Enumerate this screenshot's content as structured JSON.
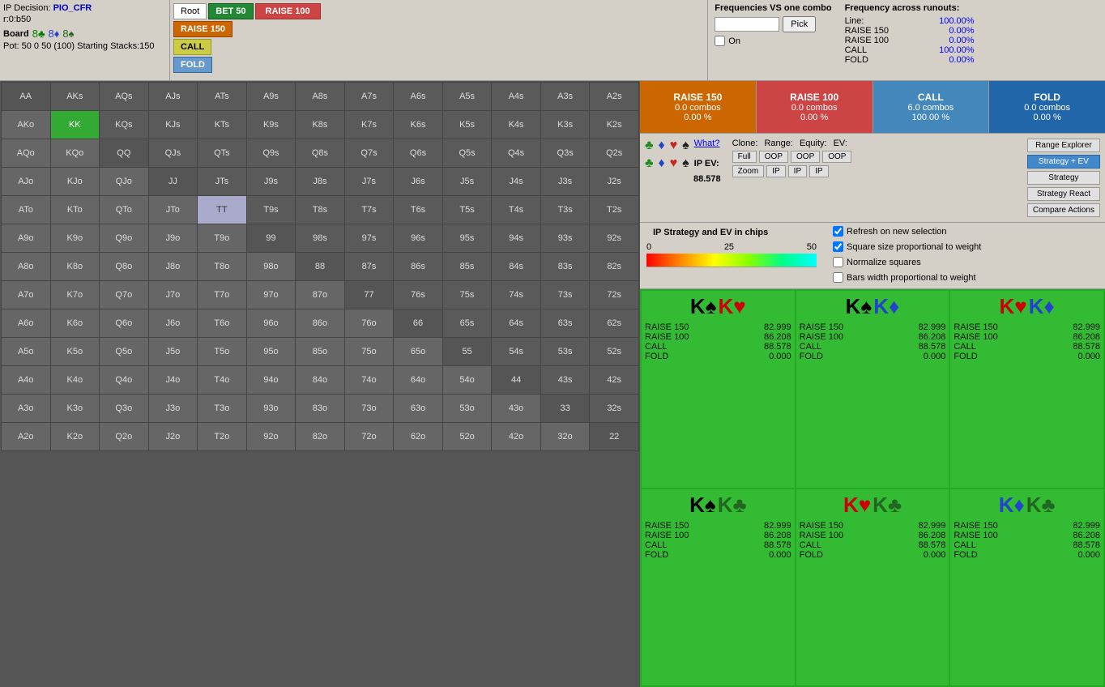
{
  "topBar": {
    "ipDecision": "IP Decision:",
    "ipDecisionValue": "PIO_CFR",
    "r0": "r:0:b50",
    "boardLabel": "Board",
    "cards": [
      "8♣",
      "8♦",
      "8♠"
    ],
    "potRow": "Pot: 50 0 50 (100) Starting Stacks:150",
    "buttons": {
      "root": "Root",
      "bet50": "BET 50",
      "raise100": "RAISE 100",
      "raise150": "RAISE 150",
      "call": "CALL",
      "fold": "FOLD"
    }
  },
  "freqPanel": {
    "title": "Frequencies VS one combo",
    "freqAcrossTitle": "Frequency across runouts:",
    "lineLabel": "Line:",
    "linePct": "100.00%",
    "onLabel": "On",
    "raise150Label": "RAISE 150",
    "raise150Pct": "0.00%",
    "raise100Label": "RAISE 100",
    "raise100Pct": "0.00%",
    "callLabel": "CALL",
    "callPct": "100.00%",
    "foldLabel": "FOLD",
    "foldPct": "0.00%"
  },
  "actionSummary": [
    {
      "name": "RAISE 150",
      "combos": "0.0 combos",
      "pct": "0.00 %",
      "color": "#cc6600"
    },
    {
      "name": "RAISE 100",
      "combos": "0.0 combos",
      "pct": "0.00 %",
      "color": "#cc4444"
    },
    {
      "name": "CALL",
      "combos": "6.0 combos",
      "pct": "100.00 %",
      "color": "#4488bb"
    },
    {
      "name": "FOLD",
      "combos": "0.0 combos",
      "pct": "0.00 %",
      "color": "#2266aa"
    }
  ],
  "controls": {
    "cloneLabel": "Clone:",
    "rangeLabel": "Range:",
    "equityLabel": "Equity:",
    "evLabel": "EV:",
    "fullBtn": "Full",
    "oopBtn1": "OOP",
    "oopBtn2": "OOP",
    "oopBtn3": "OOP",
    "zoomBtn": "Zoom",
    "ipBtn1": "IP",
    "ipBtn2": "IP",
    "ipBtn3": "IP",
    "ipEvLabel": "IP EV:",
    "ipEvValue": "88.578",
    "whatLink": "What?",
    "rangeExplorer": "Range Explorer",
    "strategyEV": "Strategy + EV",
    "strategy": "Strategy",
    "strategyReact": "Strategy React",
    "compareActions": "Compare Actions"
  },
  "checkboxes": {
    "refresh": "Refresh on new selection",
    "squareSize": "Square size proportional to weight",
    "normalizeSquares": "Normalize squares",
    "barsWidth": "Bars width proportional to weight"
  },
  "gradient": {
    "min": "0",
    "mid": "25",
    "max": "50"
  },
  "ipStrategyLabel": "IP Strategy and EV in chips",
  "combos": [
    {
      "card1": "K",
      "suit1": "spade",
      "card2": "K",
      "suit2": "heart",
      "raise150": "82.999",
      "raise100": "86.208",
      "call": "88.578",
      "fold": "0.000"
    },
    {
      "card1": "K",
      "suit1": "spade",
      "card2": "K",
      "suit2": "diamond",
      "raise150": "82.999",
      "raise100": "86.208",
      "call": "88.578",
      "fold": "0.000"
    },
    {
      "card1": "K",
      "suit1": "heart",
      "card2": "K",
      "suit2": "diamond",
      "raise150": "82.999",
      "raise100": "86.208",
      "call": "88.578",
      "fold": "0.000"
    },
    {
      "card1": "K",
      "suit1": "spade",
      "card2": "K",
      "suit2": "club",
      "raise150": "82.999",
      "raise100": "86.208",
      "call": "88.578",
      "fold": "0.000"
    },
    {
      "card1": "K",
      "suit1": "heart",
      "card2": "K",
      "suit2": "club",
      "raise150": "82.999",
      "raise100": "86.208",
      "call": "88.578",
      "fold": "0.000"
    },
    {
      "card1": "K",
      "suit1": "diamond",
      "card2": "K",
      "suit2": "club",
      "raise150": "82.999",
      "raise100": "86.208",
      "call": "88.578",
      "fold": "0.000"
    }
  ],
  "grid": {
    "rows": [
      [
        "AA",
        "AKs",
        "AQs",
        "AJs",
        "ATs",
        "A9s",
        "A8s",
        "A7s",
        "A6s",
        "A5s",
        "A4s",
        "A3s",
        "A2s"
      ],
      [
        "AKo",
        "KK",
        "KQs",
        "KJs",
        "KTs",
        "K9s",
        "K8s",
        "K7s",
        "K6s",
        "K5s",
        "K4s",
        "K3s",
        "K2s"
      ],
      [
        "AQo",
        "KQo",
        "QQ",
        "QJs",
        "QTs",
        "Q9s",
        "Q8s",
        "Q7s",
        "Q6s",
        "Q5s",
        "Q4s",
        "Q3s",
        "Q2s"
      ],
      [
        "AJo",
        "KJo",
        "QJo",
        "JJ",
        "JTs",
        "J9s",
        "J8s",
        "J7s",
        "J6s",
        "J5s",
        "J4s",
        "J3s",
        "J2s"
      ],
      [
        "ATo",
        "KTo",
        "QTo",
        "JTo",
        "TT",
        "T9s",
        "T8s",
        "T7s",
        "T6s",
        "T5s",
        "T4s",
        "T3s",
        "T2s"
      ],
      [
        "A9o",
        "K9o",
        "Q9o",
        "J9o",
        "T9o",
        "99",
        "98s",
        "97s",
        "96s",
        "95s",
        "94s",
        "93s",
        "92s"
      ],
      [
        "A8o",
        "K8o",
        "Q8o",
        "J8o",
        "T8o",
        "98o",
        "88",
        "87s",
        "86s",
        "85s",
        "84s",
        "83s",
        "82s"
      ],
      [
        "A7o",
        "K7o",
        "Q7o",
        "J7o",
        "T7o",
        "97o",
        "87o",
        "77",
        "76s",
        "75s",
        "74s",
        "73s",
        "72s"
      ],
      [
        "A6o",
        "K6o",
        "Q6o",
        "J6o",
        "T6o",
        "96o",
        "86o",
        "76o",
        "66",
        "65s",
        "64s",
        "63s",
        "62s"
      ],
      [
        "A5o",
        "K5o",
        "Q5o",
        "J5o",
        "T5o",
        "95o",
        "85o",
        "75o",
        "65o",
        "55",
        "54s",
        "53s",
        "52s"
      ],
      [
        "A4o",
        "K4o",
        "Q4o",
        "J4o",
        "T4o",
        "94o",
        "84o",
        "74o",
        "64o",
        "54o",
        "44",
        "43s",
        "42s"
      ],
      [
        "A3o",
        "K3o",
        "Q3o",
        "J3o",
        "T3o",
        "93o",
        "83o",
        "73o",
        "63o",
        "53o",
        "43o",
        "33",
        "32s"
      ],
      [
        "A2o",
        "K2o",
        "Q2o",
        "J2o",
        "T2o",
        "92o",
        "82o",
        "72o",
        "62o",
        "52o",
        "42o",
        "32o",
        "22"
      ]
    ]
  }
}
